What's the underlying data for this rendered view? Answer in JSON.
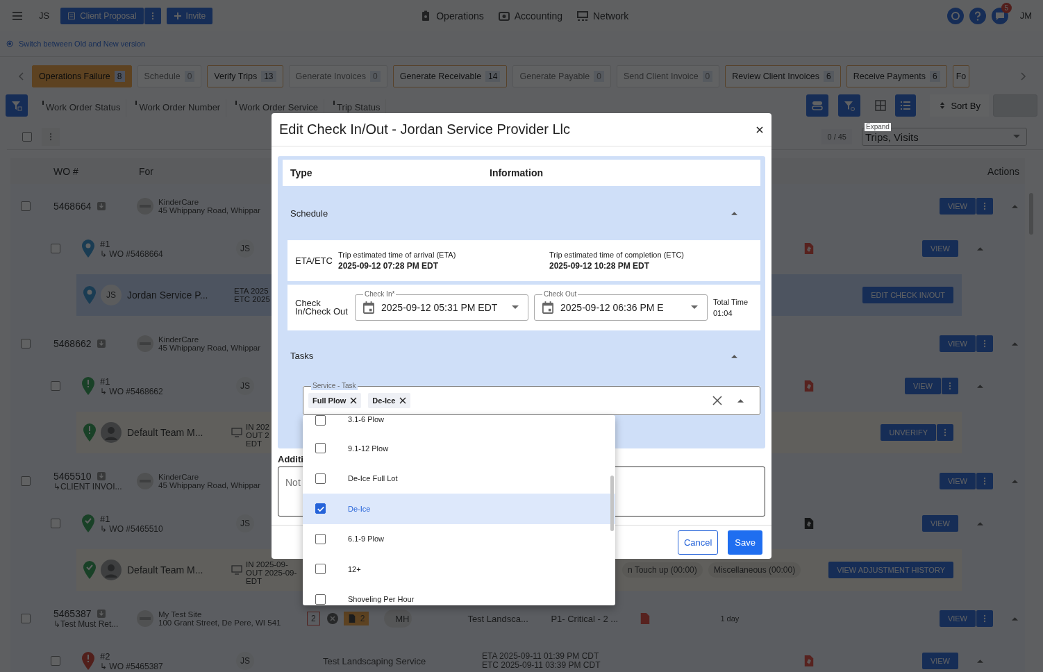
{
  "top_bar": {
    "user_initials": "JS",
    "proposal_button": "Client Proposal",
    "invite_button": "Invite",
    "nav": [
      "Operations",
      "Accounting",
      "Network"
    ],
    "notification_count": "5",
    "account_initials": "JM"
  },
  "version_link": "Switch between Old and New version",
  "stage_tabs": [
    {
      "label": "Operations Failure",
      "count": "8",
      "selected": true,
      "disabled": false
    },
    {
      "label": "Schedule",
      "count": "0",
      "selected": false,
      "disabled": true
    },
    {
      "label": "Verify Trips",
      "count": "13",
      "selected": false,
      "disabled": false
    },
    {
      "label": "Generate Invoices",
      "count": "0",
      "selected": false,
      "disabled": true
    },
    {
      "label": "Generate Receivable",
      "count": "14",
      "selected": false,
      "disabled": false
    },
    {
      "label": "Generate Payable",
      "count": "0",
      "selected": false,
      "disabled": true
    },
    {
      "label": "Send Client Invoice",
      "count": "0",
      "selected": false,
      "disabled": true
    },
    {
      "label": "Review Client Invoices",
      "count": "6",
      "selected": false,
      "disabled": false
    },
    {
      "label": "Receive Payments",
      "count": "6",
      "selected": false,
      "disabled": false
    },
    {
      "label": "Fo",
      "selected": false,
      "disabled": false
    }
  ],
  "filters": [
    "Work Order Status",
    "Work Order Number",
    "Work Order Service",
    "Trip Status"
  ],
  "view_buttons": [
    {
      "selected": false
    },
    {
      "selected": true
    }
  ],
  "sort_label": "Sort By",
  "select_all": {
    "checked": false
  },
  "page_count": "0 / 45",
  "expand": {
    "label": "Expand",
    "value": "Trips, Visits"
  },
  "table": {
    "columns": [
      "WO #",
      "For",
      "Actions"
    ],
    "rows": [
      {
        "kind": "order",
        "checked": false,
        "number": "5468664",
        "client": "KinderCare",
        "address": "45 Whippany Road, Whippar",
        "action": "VIEW",
        "expanded": true
      },
      {
        "kind": "trip",
        "checked": false,
        "label": "#1",
        "wo": "↳ WO #5468664",
        "pin": {
          "kind": "scheduled"
        },
        "initials": "JS",
        "invoice": {
          "kind": "pending"
        },
        "action": "VIEW",
        "menu": false,
        "expanded": true
      },
      {
        "kind": "visit",
        "selected": true,
        "pin": {
          "kind": "scheduled"
        },
        "avatar": {
          "kind": "initials",
          "text": "JS"
        },
        "name": "Jordan Service P...",
        "times": [
          "ETA 2025",
          "ETC 2025"
        ],
        "device": false,
        "action": "EDIT CHECK IN/OUT",
        "menu": false
      },
      {
        "kind": "order",
        "checked": false,
        "number": "5468662",
        "client": "KinderCare",
        "address": "45 Whippany Road, Whippar",
        "action": "VIEW",
        "expanded": true
      },
      {
        "kind": "trip",
        "checked": false,
        "label": "#1",
        "wo": "↳ WO #5468662",
        "pin": {
          "kind": "flagged"
        },
        "initials": "JS",
        "invoice": {
          "kind": "pending"
        },
        "action": "VIEW",
        "menu": true,
        "expanded": true
      },
      {
        "kind": "visit",
        "selected": false,
        "pin": {
          "kind": "flagged"
        },
        "avatar": {
          "kind": "person"
        },
        "name": "Default Team M...",
        "times": [
          "IN 202",
          "OUT 2",
          "EDT"
        ],
        "device": true,
        "action": "UNVERIFY",
        "menu": true
      },
      {
        "kind": "order",
        "checked": false,
        "number": "5465510",
        "sub": "↳CLIENT INVOI...",
        "client": "KinderCare",
        "address": "45 Whippany Road, Whippar",
        "action": "VIEW",
        "expanded": true
      },
      {
        "kind": "trip",
        "checked": false,
        "label": "#1",
        "wo": "↳ WO #5465510",
        "pin": {
          "kind": "verified"
        },
        "initials": "JS",
        "invoice": {
          "kind": "paid"
        },
        "action": "VIEW",
        "menu": false,
        "expanded": true
      },
      {
        "kind": "visit",
        "selected": false,
        "pin": {
          "kind": "verified"
        },
        "avatar": {
          "kind": "person"
        },
        "name": "Default Team M...",
        "times": [
          "IN 2025-09-",
          "OUT 2025-09-",
          "EDT"
        ],
        "device": true,
        "chips": [
          "n Touch up (00:00)",
          "Miscellaneous (00:00)"
        ],
        "action": "VIEW ADJUSTMENT HISTORY",
        "menu": false
      },
      {
        "kind": "order",
        "checked": false,
        "number": "5465387",
        "sub": "↳Test Must Ret...",
        "client": "My Test Site",
        "address": "100 Grant Street, De Pere, WI 541",
        "middle": {
          "trips": "2",
          "docs": "2",
          "initials": "MH",
          "provider": "Test Landsca...",
          "priority": "P1- Critical - 2 ...",
          "age": "1 day"
        },
        "action": "VIEW",
        "expanded": true
      },
      {
        "kind": "trip",
        "checked": false,
        "label": "#2",
        "wo": "↳ WO #5465387",
        "pin": {
          "kind": "overdue"
        },
        "initials": "JS",
        "service": "Test Landscaping Service",
        "times": [
          "ETA 2025-09-11 01:39 PM CDT",
          "ETC 2025-09-11 03:39 PM CDT"
        ],
        "invoice": {
          "kind": "pending"
        },
        "action": "VIEW",
        "menu": false,
        "expanded": true
      }
    ]
  },
  "dialog": {
    "title": "Edit Check In/Out - Jordan Service Provider Llc",
    "columns": [
      "Type",
      "Information"
    ],
    "schedule": {
      "title": "Schedule",
      "expanded": true,
      "eta_etc": {
        "type": "ETA/ETC",
        "eta_label": "Trip estimated time of arrival (ETA)",
        "eta": "2025-09-12 07:28 PM EDT",
        "etc_label": "Trip estimated time of completion (ETC)",
        "etc": "2025-09-12 10:28 PM EDT"
      },
      "check": {
        "type": "Check In/Check Out",
        "check_in": {
          "label": "Check In*",
          "value": "2025-09-12 05:31 PM EDT"
        },
        "check_out": {
          "label": "Check Out",
          "value": "2025-09-12 06:36 PM E"
        },
        "total_label": "Total Time",
        "total": "01:04"
      }
    },
    "tasks": {
      "title": "Tasks",
      "expanded": true,
      "field_label": "Service - Task",
      "chips": [
        "Full Plow",
        "De-Ice"
      ],
      "open": true,
      "options": [
        {
          "label": "3.1-6 Plow",
          "checked": false,
          "selected": false
        },
        {
          "label": "9.1-12 Plow",
          "checked": false,
          "selected": false
        },
        {
          "label": "De-Ice Full Lot",
          "checked": false,
          "selected": false
        },
        {
          "label": "De-Ice",
          "checked": true,
          "selected": true
        },
        {
          "label": "6.1-9 Plow",
          "checked": false,
          "selected": false
        },
        {
          "label": "12+",
          "checked": false,
          "selected": false
        },
        {
          "label": "Shoveling Per Hour",
          "checked": false,
          "selected": false
        }
      ]
    },
    "notes": {
      "label": "Additi",
      "placeholder": "Not"
    },
    "cancel": "Cancel",
    "save": "Save"
  }
}
